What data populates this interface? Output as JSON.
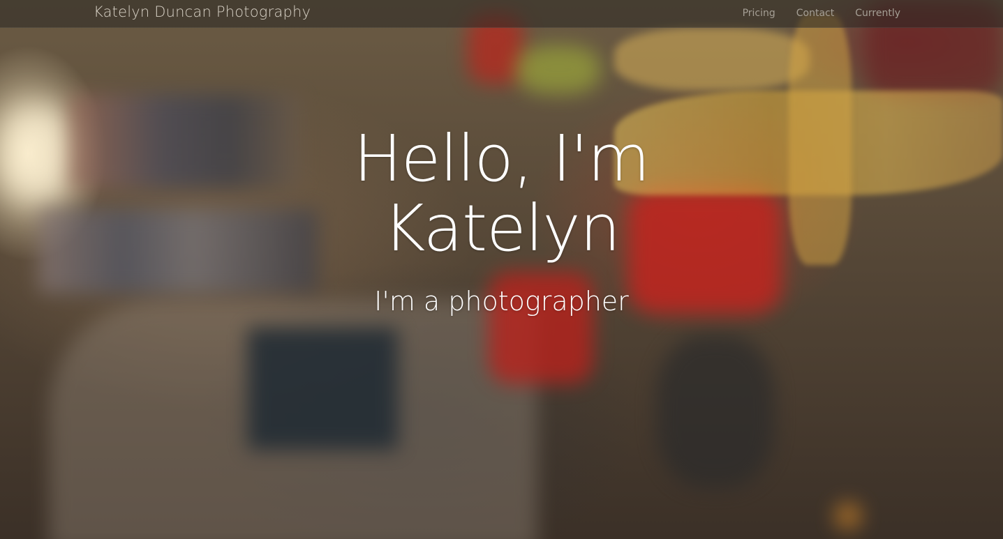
{
  "nav": {
    "brand": "Katelyn Duncan Photography",
    "links": [
      {
        "label": "Pricing"
      },
      {
        "label": "Contact"
      },
      {
        "label": "Currently"
      }
    ]
  },
  "hero": {
    "headline_line1": "Hello, I'm",
    "headline_line2": "Katelyn",
    "tagline": "I'm a photographer",
    "background_image": "blurred photo of colorful origami paper cranes hanging in a room"
  }
}
